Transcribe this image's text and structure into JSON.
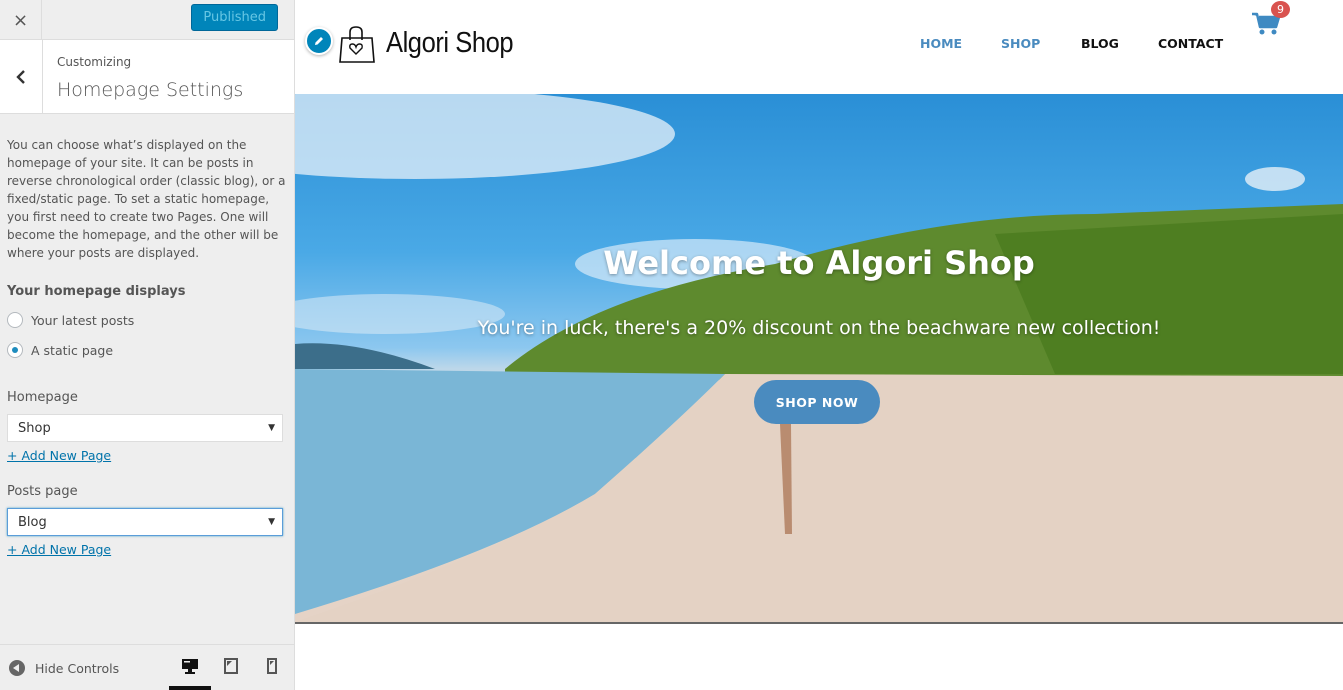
{
  "customizer": {
    "close_label": "×",
    "publish_label": "Published",
    "back_label": "‹",
    "breadcrumb": "Customizing",
    "section_title": "Homepage Settings",
    "description": "You can choose what’s displayed on the homepage of your site. It can be posts in reverse chronological order (classic blog), or a fixed/static page. To set a static homepage, you first need to create two Pages. One will become the homepage, and the other will be where your posts are displayed.",
    "homepage_displays": {
      "label": "Your homepage displays",
      "options": [
        {
          "label": "Your latest posts",
          "checked": false
        },
        {
          "label": "A static page",
          "checked": true
        }
      ]
    },
    "homepage_field": {
      "label": "Homepage",
      "value": "Shop",
      "add_link": "+ Add New Page"
    },
    "posts_page_field": {
      "label": "Posts page",
      "value": "Blog",
      "add_link": "+ Add New Page"
    },
    "footer": {
      "hide_controls_label": "Hide Controls",
      "devices": [
        {
          "icon": "desktop-icon",
          "active": true
        },
        {
          "icon": "tablet-icon",
          "active": false
        },
        {
          "icon": "mobile-icon",
          "active": false
        }
      ]
    }
  },
  "site": {
    "title": "Algori Shop",
    "nav": [
      {
        "label": "HOME",
        "color": "#4a8bbf"
      },
      {
        "label": "SHOP",
        "color": "#4a8bbf"
      },
      {
        "label": "BLOG",
        "color": "#111111"
      },
      {
        "label": "CONTACT",
        "color": "#111111"
      }
    ],
    "cart_count": "9",
    "hero": {
      "title": "Welcome to Algori Shop",
      "subtitle": "You're in luck, there's a 20% discount on the beachware new collection!",
      "button_label": "SHOP NOW"
    }
  },
  "colors": {
    "accent": "#0085ba",
    "link": "#0073aa",
    "button": "#4a8bbf",
    "badge": "#d9534f"
  }
}
